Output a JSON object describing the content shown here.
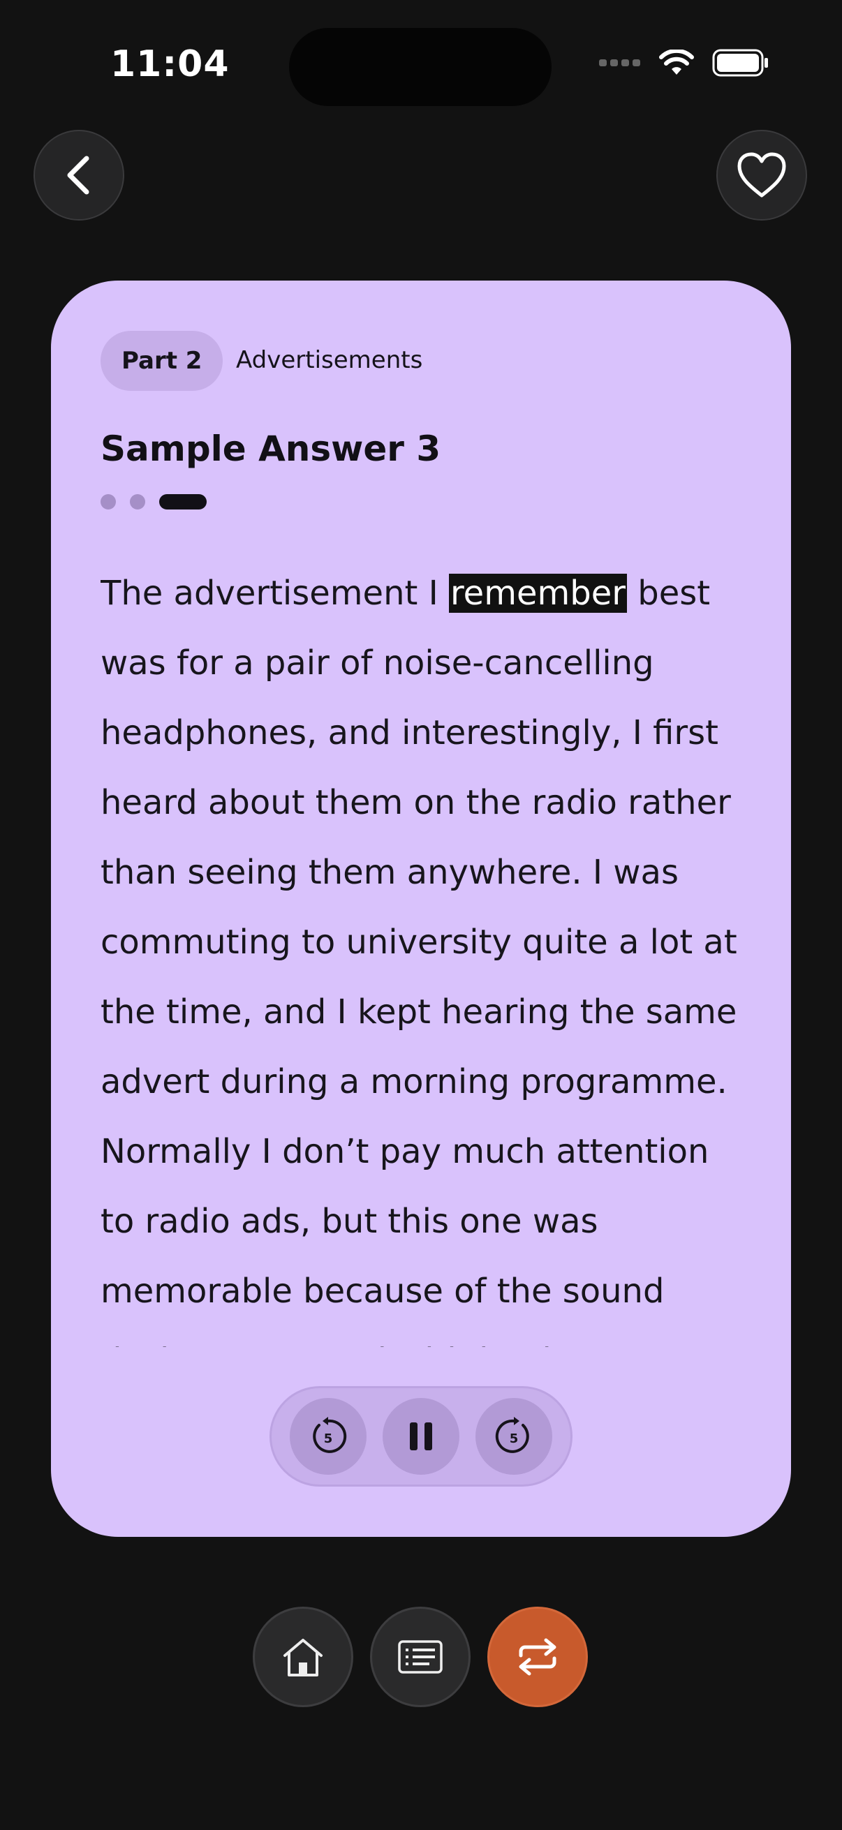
{
  "status_bar": {
    "time": "11:04"
  },
  "card": {
    "part_label": "Part 2",
    "topic": "Advertisements",
    "title": "Sample Answer 3",
    "answer_before": "The advertisement I ",
    "answer_highlight": "remember",
    "answer_after": " best was for a pair of noise-cancelling headphones, and interestingly, I first heard about them on the radio rather than seeing them anywhere. I was commuting to university quite a lot at the time, and I kept hearing the same advert during a morning programme. Normally I don’t pay much attention to radio ads, but this one was memorable because of the sound design. It started with loud background noise like traffic"
  },
  "player": {
    "rewind_seconds": "5",
    "forward_seconds": "5"
  },
  "colors": {
    "card": "#d9c2fc",
    "accent": "#c85a2c",
    "background": "#121212"
  },
  "icons": [
    "back-arrow-icon",
    "heart-icon",
    "rewind-5-icon",
    "pause-icon",
    "forward-5-icon",
    "home-icon",
    "list-icon",
    "repeat-icon"
  ]
}
